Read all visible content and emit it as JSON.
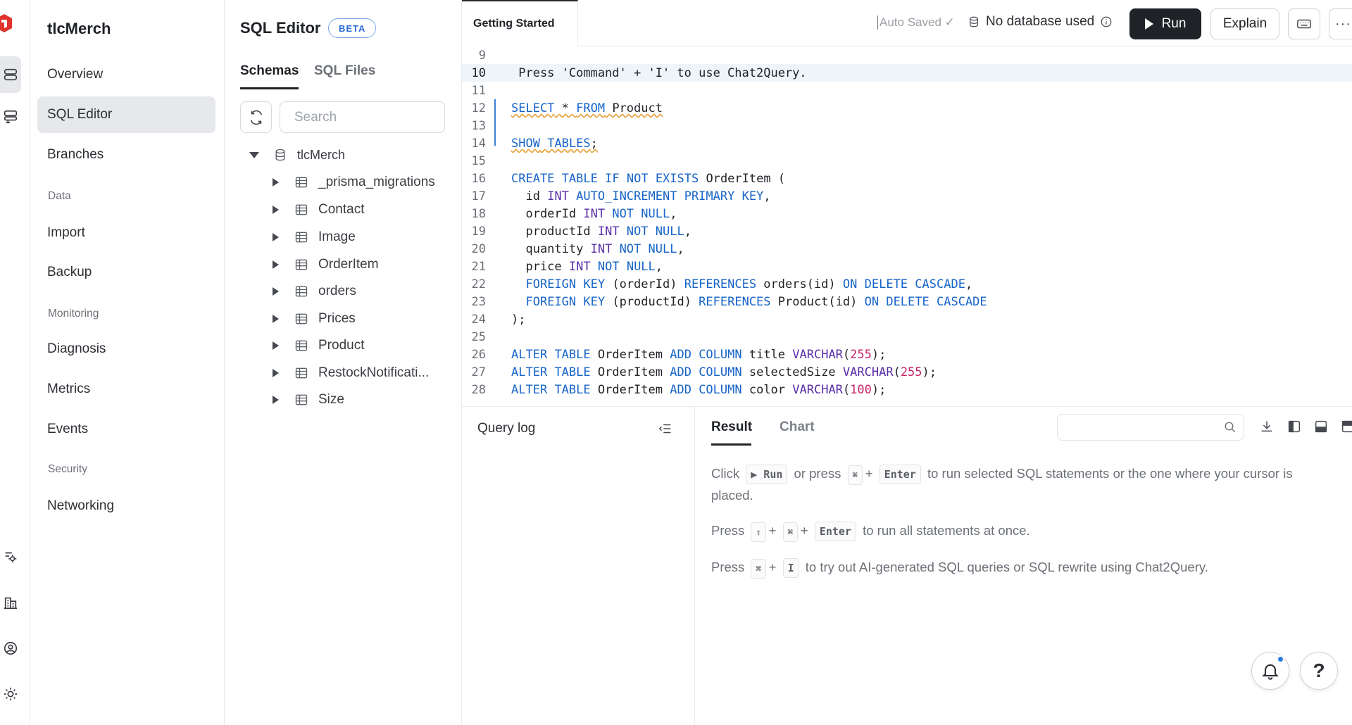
{
  "org_name": "tlcMerch",
  "nav": {
    "items": [
      {
        "label": "Overview"
      },
      {
        "label": "SQL Editor"
      },
      {
        "label": "Branches"
      },
      {
        "label": "Import"
      },
      {
        "label": "Backup"
      },
      {
        "label": "Diagnosis"
      },
      {
        "label": "Metrics"
      },
      {
        "label": "Events"
      },
      {
        "label": "Networking"
      }
    ],
    "sections": [
      "Data",
      "Monitoring",
      "Security"
    ],
    "active": "SQL Editor"
  },
  "schema_panel": {
    "title": "SQL Editor",
    "badge": "BETA",
    "tabs": [
      "Schemas",
      "SQL Files"
    ],
    "search_placeholder": "Search",
    "database": "tlcMerch",
    "tables": [
      "_prisma_migrations",
      "Contact",
      "Image",
      "OrderItem",
      "orders",
      "Prices",
      "Product",
      "RestockNotificati...",
      "Size"
    ]
  },
  "editor": {
    "tab": "Getting Started",
    "status": "Auto Saved",
    "database_status": "No database used",
    "run_label": "Run",
    "explain_label": "Explain",
    "more_label": "···",
    "line_numbers": [
      "9",
      "10",
      "11",
      "12",
      "13",
      "14",
      "15",
      "16",
      "17",
      "18",
      "19",
      "20",
      "21",
      "22",
      "23",
      "24",
      "25",
      "26",
      "27",
      "28"
    ],
    "hint_line": " Press 'Command' + 'I' to use Chat2Query."
  },
  "bottom": {
    "query_log_title": "Query log",
    "result_tabs": [
      "Result",
      "Chart"
    ],
    "help": {
      "line1_pre": "Click",
      "run_key": "Run",
      "or_press": "or press",
      "cmd": "⌘",
      "plus": "+",
      "enter": "Enter",
      "line1_post": "to run selected SQL statements or the one where your cursor is placed.",
      "line2_pre": "Press",
      "shift": "⇧",
      "line2_post": "to run all statements at once.",
      "line3_pre": "Press",
      "i_key": "I",
      "line3_post": "to try out AI-generated SQL queries or SQL rewrite using Chat2Query."
    }
  },
  "icons": {
    "rail": [
      "logo-icon",
      "database-icon",
      "cluster-icon",
      "settings-icon",
      "building-icon",
      "user-icon",
      "sun-icon"
    ],
    "fabs": [
      "bell-icon",
      "help-icon"
    ]
  },
  "colors": {
    "keyword": "#1764c8",
    "type": "#5a2ea8",
    "number": "#c9236a",
    "accent": "#2b7bde",
    "logo": "#e0332e"
  }
}
